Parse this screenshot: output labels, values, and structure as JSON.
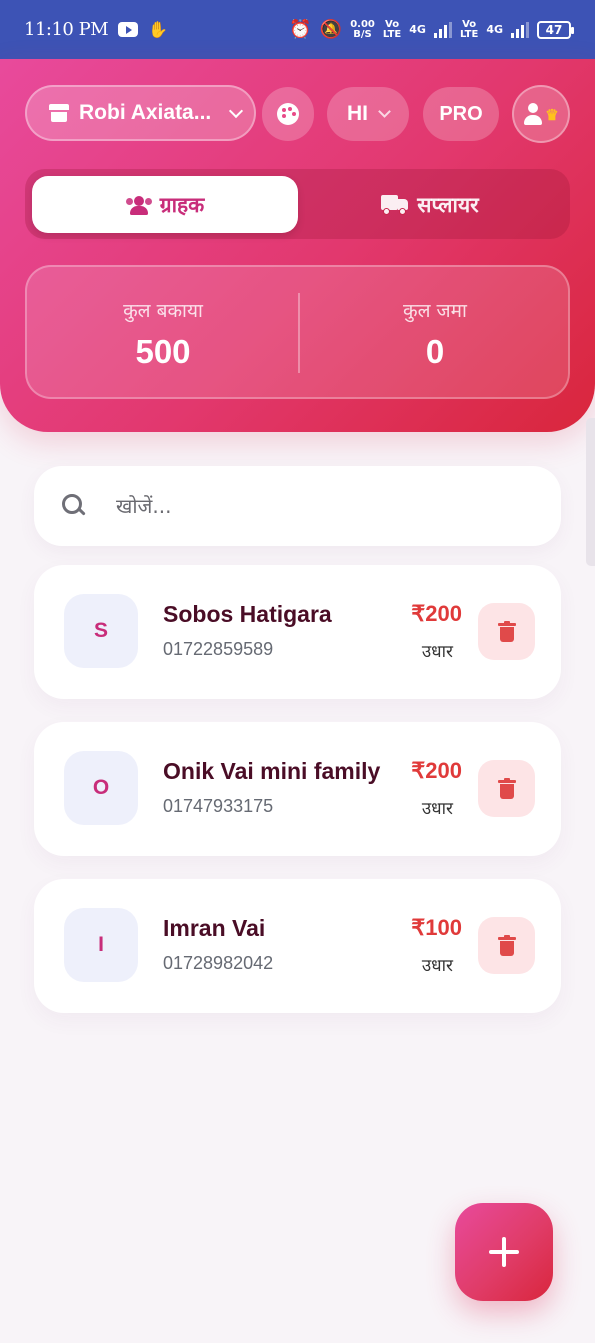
{
  "status_bar": {
    "time": "11:10 PM",
    "net_speed_value": "0.00",
    "net_speed_unit": "B/S",
    "sim1_label_top": "Vo",
    "sim1_label_bottom": "LTE",
    "sim1_network": "4G",
    "sim2_label_top": "Vo",
    "sim2_label_bottom": "LTE",
    "sim2_network": "4G",
    "battery": "47"
  },
  "header": {
    "shop_name": "Robi Axiata...",
    "language": "HI",
    "pro_label": "PRO",
    "tabs": [
      {
        "label": "ग्राहक",
        "active": true
      },
      {
        "label": "सप्लायर",
        "active": false
      }
    ],
    "summary": {
      "total_due_label": "कुल बकाया",
      "total_due_value": "500",
      "total_deposit_label": "कुल जमा",
      "total_deposit_value": "0"
    }
  },
  "search": {
    "placeholder": "खोजें..."
  },
  "customers": [
    {
      "initial": "S",
      "name": "Sobos Hatigara",
      "phone": "01722859589",
      "amount": "₹200",
      "status": "उधार"
    },
    {
      "initial": "O",
      "name": "Onik Vai mini family",
      "phone": "01747933175",
      "amount": "₹200",
      "status": "उधार"
    },
    {
      "initial": "I",
      "name": "Imran Vai",
      "phone": "01728982042",
      "amount": "₹100",
      "status": "उधार"
    }
  ],
  "colors": {
    "status_bar": "#3d53b5",
    "header_start": "#e84a9c",
    "header_end": "#d9263c",
    "accent": "#c82d7a",
    "amount_due": "#e03a3a",
    "name_text": "#4a0d26"
  },
  "icons": [
    "store-icon",
    "chevron-down-icon",
    "palette-icon",
    "user-icon",
    "crown-icon",
    "users-icon",
    "truck-icon",
    "search-icon",
    "trash-icon",
    "plus-icon"
  ]
}
